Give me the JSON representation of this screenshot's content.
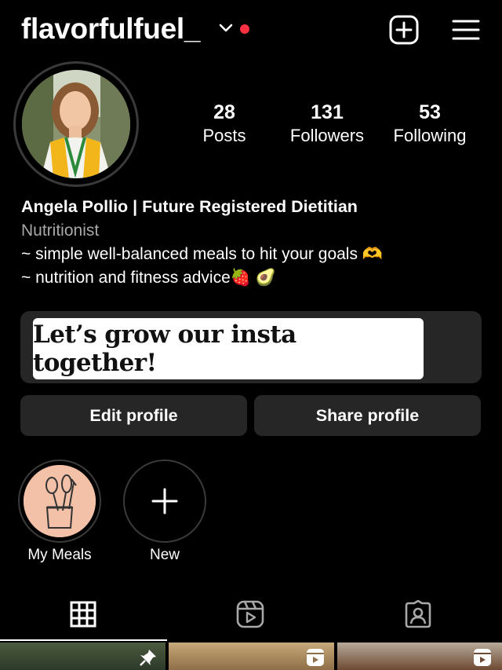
{
  "header": {
    "username": "flavorfulfuel_",
    "create_icon": "plus-square-icon",
    "menu_icon": "hamburger-menu-icon",
    "notification_dot_color": "#ff3040"
  },
  "stats": [
    {
      "value": "28",
      "label": "Posts"
    },
    {
      "value": "131",
      "label": "Followers"
    },
    {
      "value": "53",
      "label": "Following"
    }
  ],
  "bio": {
    "name": "Angela Pollio | Future Registered Dietitian",
    "category": "Nutritionist",
    "line1": "~ simple well-balanced meals to hit your goals 🫶",
    "line2": "~ nutrition and fitness advice🍓 🥑"
  },
  "banner": {
    "text": "Let’s grow our insta together!"
  },
  "buttons": {
    "edit": "Edit profile",
    "share": "Share profile"
  },
  "highlights": [
    {
      "label": "My Meals",
      "icon": "kitchen-utensils-icon"
    },
    {
      "label": "New",
      "icon": "plus-icon"
    }
  ],
  "tabs": [
    {
      "name": "grid",
      "icon": "grid-icon",
      "active": true
    },
    {
      "name": "reels",
      "icon": "reels-icon",
      "active": false
    },
    {
      "name": "tagged",
      "icon": "tagged-person-icon",
      "active": false
    }
  ],
  "colors": {
    "background": "#000000",
    "button_bg": "#262626",
    "muted_text": "#a8a8a8"
  }
}
